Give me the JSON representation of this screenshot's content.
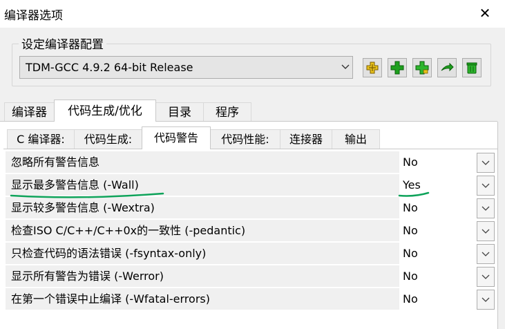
{
  "window": {
    "title": "编译器选项",
    "close_glyph": "✕"
  },
  "compiler_set": {
    "group_label": "设定编译器配置",
    "selected": "TDM-GCC 4.9.2 64-bit Release",
    "buttons": [
      "add-default-icon",
      "add-plus-icon",
      "add-folder-icon",
      "rename-icon",
      "delete-trash-icon"
    ]
  },
  "main_tabs": [
    {
      "label": "编译器"
    },
    {
      "label": "代码生成/优化"
    },
    {
      "label": "目录"
    },
    {
      "label": "程序"
    }
  ],
  "sub_tabs": [
    {
      "label": "C 编译器:"
    },
    {
      "label": "代码生成:"
    },
    {
      "label": "代码警告"
    },
    {
      "label": "代码性能:"
    },
    {
      "label": "连接器"
    },
    {
      "label": "输出"
    }
  ],
  "options": [
    {
      "name": "忽略所有警告信息",
      "value": "No"
    },
    {
      "name": "显示最多警告信息 (-Wall)",
      "value": "Yes"
    },
    {
      "name": "显示较多警告信息 (-Wextra)",
      "value": "No"
    },
    {
      "name": "检查ISO C/C++/C++0x的一致性 (-pedantic)",
      "value": "No"
    },
    {
      "name": "只检查代码的语法错误 (-fsyntax-only)",
      "value": "No"
    },
    {
      "name": "显示所有警告为错误 (-Werror)",
      "value": "No"
    },
    {
      "name": "在第一个错误中止编译 (-Wfatal-errors)",
      "value": "No"
    }
  ],
  "colors": {
    "annotation_green": "#0ea35a",
    "button_green": "#1ea01e"
  }
}
